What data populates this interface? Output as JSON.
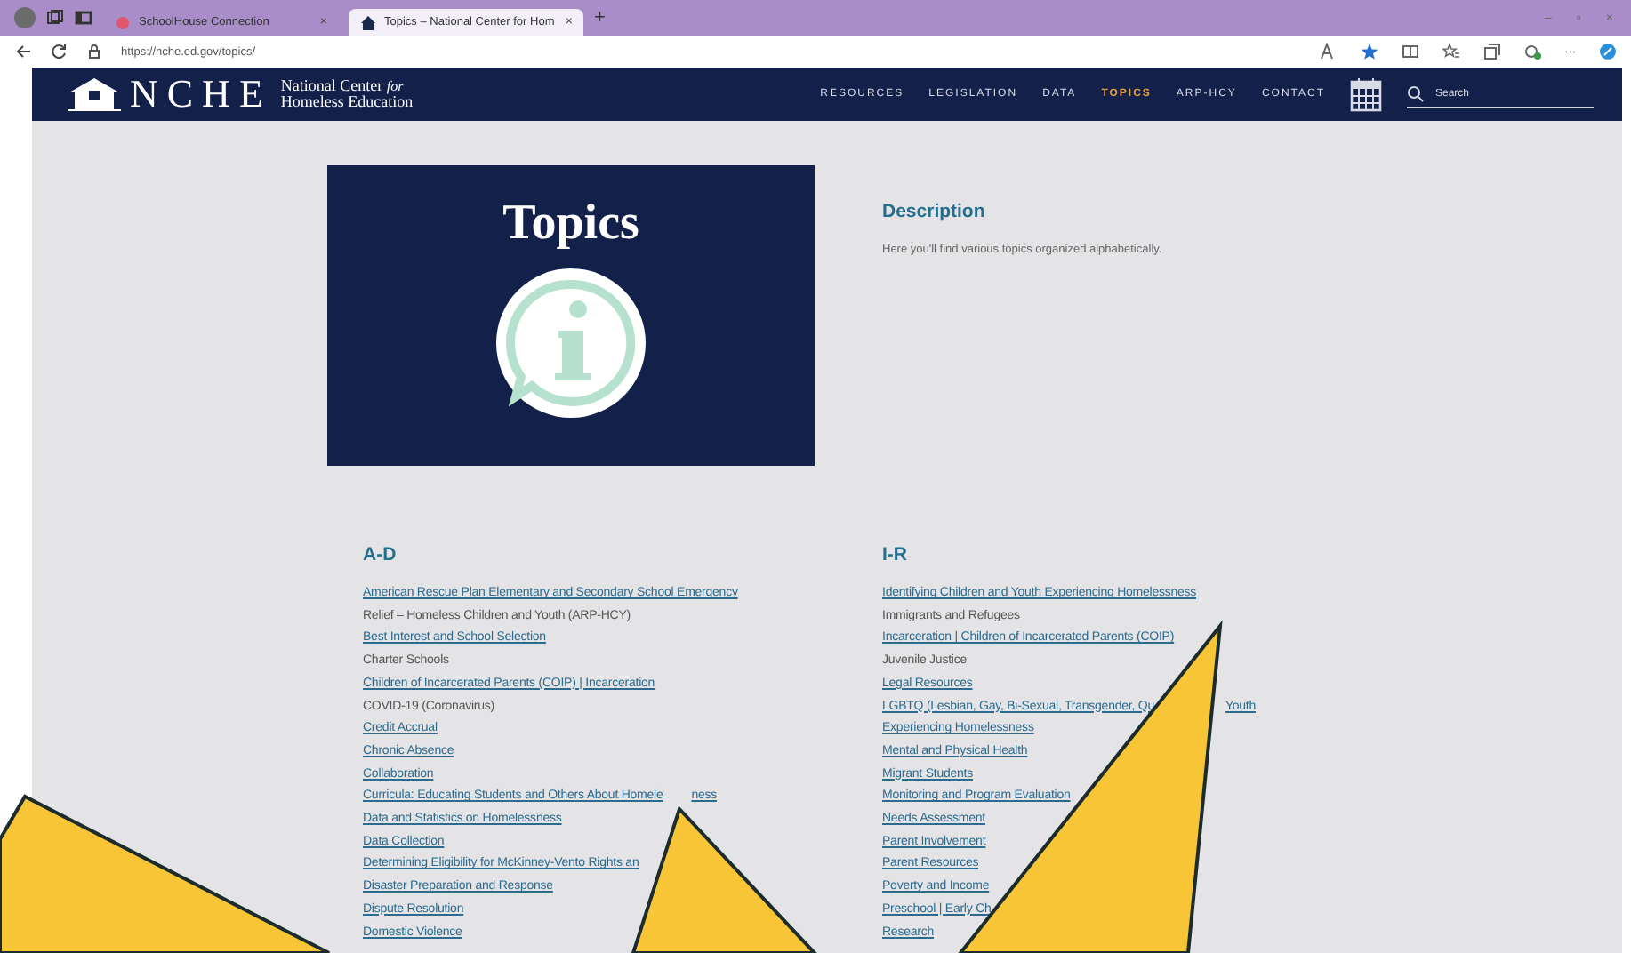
{
  "browser": {
    "tabs": [
      {
        "title": "SchoolHouse Connection",
        "selected": false
      },
      {
        "title": "Topics – National Center for Hom",
        "selected": true
      }
    ],
    "tab_close": "×",
    "new_tab": "+",
    "url": "https://nche.ed.gov/topics/",
    "more": "···",
    "window_controls": [
      "–",
      "▫",
      "×"
    ]
  },
  "header": {
    "logo_letters": "NCHE",
    "logo_line1": "National Center",
    "logo_for": "for",
    "logo_line2": "Homeless Education",
    "nav": [
      {
        "label": "RESOURCES",
        "selected": false
      },
      {
        "label": "LEGISLATION",
        "selected": false
      },
      {
        "label": "DATA",
        "selected": false
      },
      {
        "label": "TOPICS",
        "selected": true
      },
      {
        "label": "ARP-HCY",
        "selected": false
      },
      {
        "label": "CONTACT",
        "selected": false
      }
    ],
    "search": {
      "placeholder": "Search"
    }
  },
  "hero": {
    "title": "Topics"
  },
  "description": {
    "heading": "Description",
    "text": "Here you'll find various topics organized alphabetically."
  },
  "columns": [
    {
      "heading": "A-D",
      "items": [
        {
          "text": "American Rescue Plan Elementary and Secondary School Emergency",
          "link": true
        },
        {
          "text": "Relief – Homeless Children and Youth (ARP-HCY)",
          "link": false
        },
        {
          "text": "Best Interest and School Selection",
          "link": true
        },
        {
          "text": "Charter Schools",
          "link": false
        },
        {
          "text": "Children of Incarcerated Parents (COIP) | Incarceration",
          "link": true
        },
        {
          "text": "COVID-19 (Coronavirus)",
          "link": false
        },
        {
          "text": "Credit Accrual",
          "link": true
        },
        {
          "text": "Chronic Absence",
          "link": true
        },
        {
          "text": "Collaboration",
          "link": true
        },
        {
          "text": "Curricula: Educating Students and Others About Homele",
          "tail": "ness",
          "link": true
        },
        {
          "text": "Data and Statistics on Homelessness",
          "link": true
        },
        {
          "text": "Data Collection",
          "link": true
        },
        {
          "text": "Determining Eligibility for McKinney-Vento Rights an",
          "link": true
        },
        {
          "text": "Disaster Preparation and Response",
          "link": true
        },
        {
          "text": "Dispute Resolution",
          "link": true
        },
        {
          "text": "Domestic Violence",
          "link": true
        }
      ]
    },
    {
      "heading": "I-R",
      "items": [
        {
          "text": "Identifying Children and Youth Experiencing Homelessness",
          "link": true
        },
        {
          "text": "Immigrants and Refugees",
          "link": false
        },
        {
          "text": "Incarceration | Children of Incarcerated Parents (COIP)",
          "link": true
        },
        {
          "text": "Juvenile Justice",
          "link": false
        },
        {
          "text": "Legal Resources",
          "link": true
        },
        {
          "text": "LGBTQ (Lesbian, Gay, Bi-Sexual, Transgender, Qu",
          "tail": "Youth",
          "link": true
        },
        {
          "text": "Experiencing Homelessness",
          "link": true
        },
        {
          "text": "Mental and Physical Health",
          "link": true
        },
        {
          "text": "Migrant Students",
          "link": true
        },
        {
          "text": "Monitoring and Program Evaluation",
          "link": true
        },
        {
          "text": "Needs Assessment",
          "link": true
        },
        {
          "text": "Parent Involvement",
          "link": true
        },
        {
          "text": "Parent Resources",
          "link": true
        },
        {
          "text": "Poverty and Income",
          "link": true
        },
        {
          "text": "Preschool | Early Ch",
          "link": true
        },
        {
          "text": "Research",
          "link": true
        }
      ]
    }
  ]
}
